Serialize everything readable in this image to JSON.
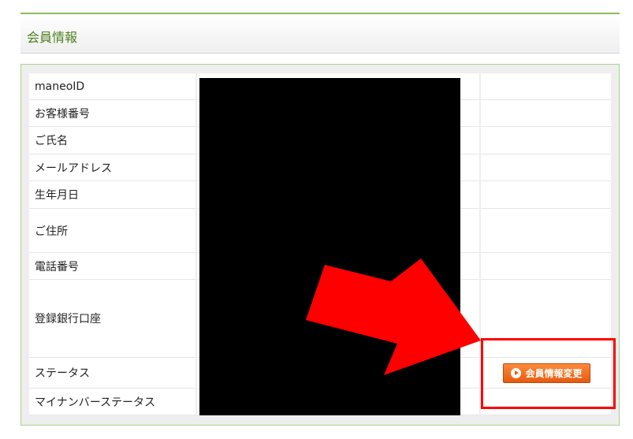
{
  "section": {
    "title": "会員情報"
  },
  "rows": [
    {
      "label": "maneoID"
    },
    {
      "label": "お客様番号"
    },
    {
      "label": "ご氏名"
    },
    {
      "label": "メールアドレス"
    },
    {
      "label": "生年月日"
    },
    {
      "label": "ご住所"
    },
    {
      "label": "電話番号"
    },
    {
      "label": "登録銀行口座"
    },
    {
      "label": "ステータス"
    },
    {
      "label": "マイナンバーステータス"
    }
  ],
  "edit_button": {
    "label": "会員情報変更",
    "icon": "play-circle-icon"
  },
  "colors": {
    "accent": "#4a7f1e",
    "button": "#e85a10",
    "highlight": "#ff0000"
  }
}
